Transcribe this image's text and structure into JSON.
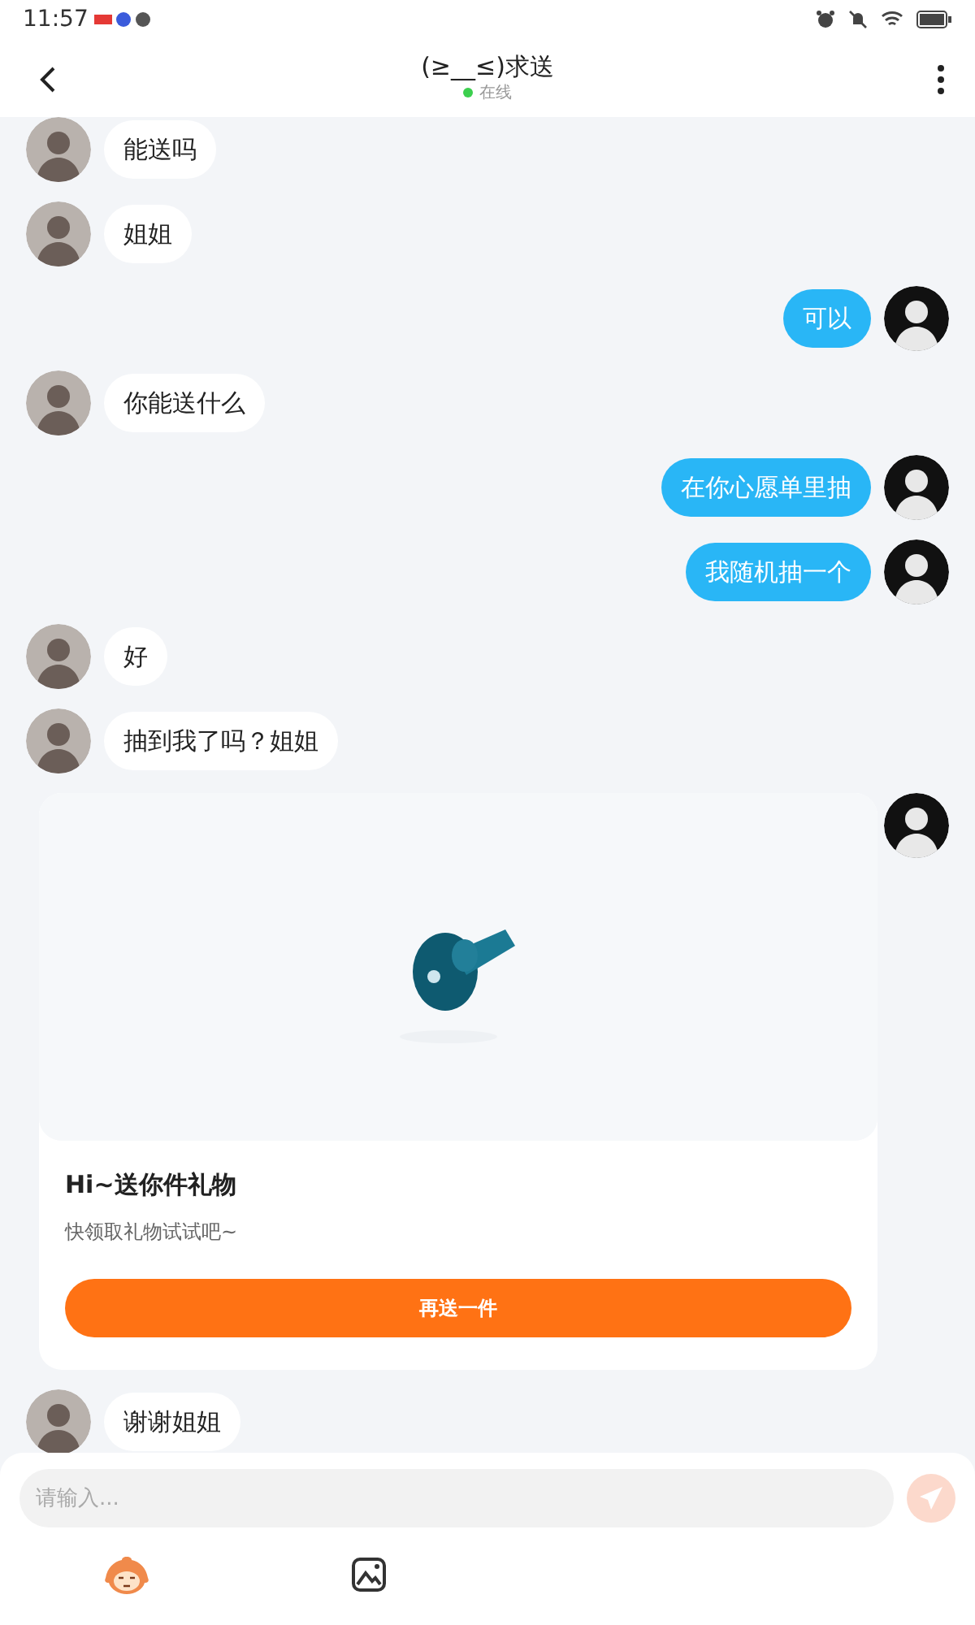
{
  "status_bar": {
    "time": "11:57"
  },
  "header": {
    "title": "(≥__≤)求送",
    "status": {
      "text": "在线",
      "online": true
    }
  },
  "messages": [
    {
      "kind": "text",
      "outgoing": false,
      "text": "能送吗"
    },
    {
      "kind": "text",
      "outgoing": false,
      "text": "姐姐"
    },
    {
      "kind": "text",
      "outgoing": true,
      "text": "可以"
    },
    {
      "kind": "text",
      "outgoing": false,
      "text": "你能送什么"
    },
    {
      "kind": "text",
      "outgoing": true,
      "text": "在你心愿单里抽"
    },
    {
      "kind": "text",
      "outgoing": true,
      "text": "我随机抽一个"
    },
    {
      "kind": "text",
      "outgoing": false,
      "text": "好"
    },
    {
      "kind": "text",
      "outgoing": false,
      "text": "抽到我了吗？姐姐"
    },
    {
      "kind": "gift",
      "outgoing": true,
      "title": "Hi~送你件礼物",
      "subtitle": "快领取礼物试试吧~",
      "button": "再送一件"
    },
    {
      "kind": "text",
      "outgoing": false,
      "text": "谢谢姐姐"
    }
  ],
  "composer": {
    "placeholder": "请输入...",
    "send_disabled": true
  }
}
